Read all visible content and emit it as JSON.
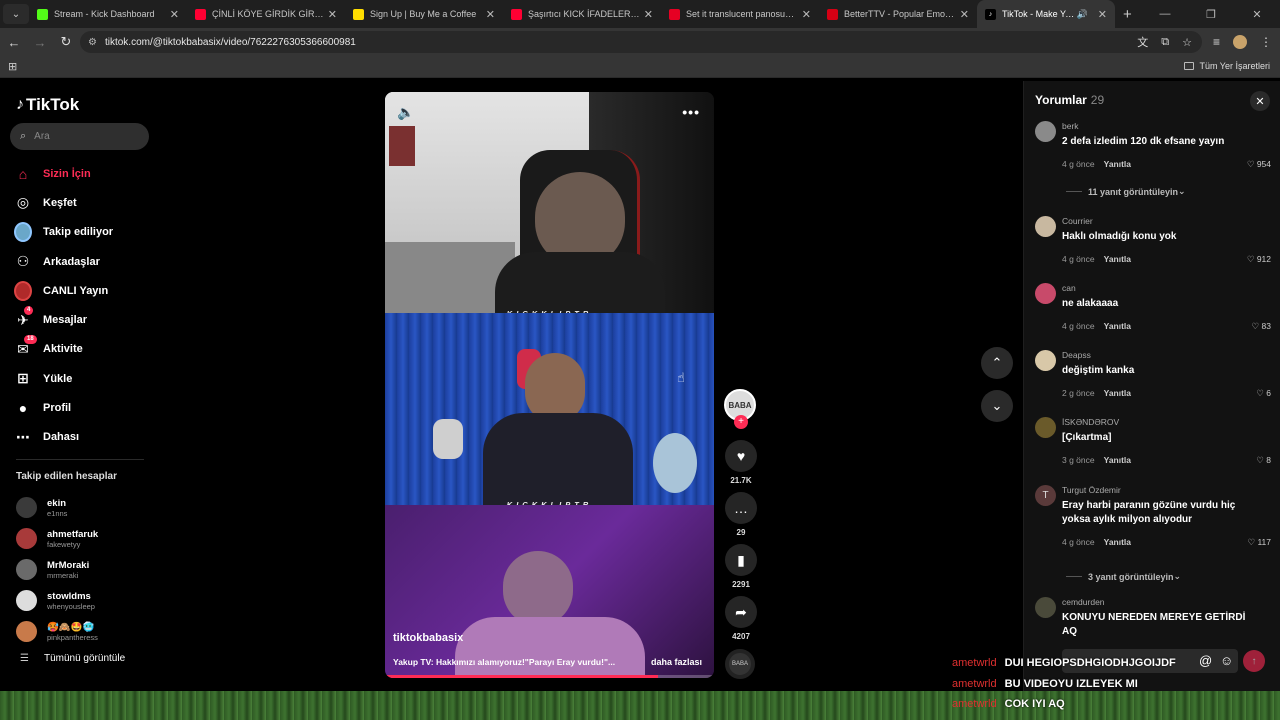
{
  "browser": {
    "tabs": [
      {
        "label": "Stream - Kick Dashboard",
        "icon": "kick-icon",
        "color": "#53fc18"
      },
      {
        "label": "ÇİNLİ KÖYE GİRDİK GİRMEZ OL",
        "icon": "youtube-icon",
        "color": "#ff0033"
      },
      {
        "label": "Sign Up | Buy Me a Coffee",
        "icon": "buymeacoffee-icon",
        "color": "#ffdd00"
      },
      {
        "label": "Şaşırtıcı KICK İFADELERİ ve GİF",
        "icon": "youtube-icon",
        "color": "#ff0033"
      },
      {
        "label": "Set it translucent panosundaki",
        "icon": "pinterest-icon",
        "color": "#e60023"
      },
      {
        "label": "BetterTTV - Popular Emotes",
        "icon": "betterttv-icon",
        "color": "#d50014"
      },
      {
        "label": "TikTok - Make Your Day",
        "icon": "tiktok-icon",
        "color": "#000000"
      }
    ],
    "url": "tiktok.com/@tiktokbabasix/video/7622276305366600981",
    "bookmarks_all": "Tüm Yer İşaretleri"
  },
  "sidebar": {
    "logo": "TikTok",
    "search_placeholder": "Ara",
    "nav": [
      {
        "label": "Sizin İçin",
        "icon": "home-icon",
        "active": true
      },
      {
        "label": "Keşfet",
        "icon": "compass-icon"
      },
      {
        "label": "Takip ediliyor",
        "icon": "following-avatar-icon"
      },
      {
        "label": "Arkadaşlar",
        "icon": "friends-icon"
      },
      {
        "label": "CANLI Yayın",
        "icon": "live-avatar-icon"
      },
      {
        "label": "Mesajlar",
        "icon": "messages-icon",
        "badge": "4"
      },
      {
        "label": "Aktivite",
        "icon": "activity-icon",
        "badge": "18"
      },
      {
        "label": "Yükle",
        "icon": "upload-icon"
      },
      {
        "label": "Profil",
        "icon": "profile-icon"
      },
      {
        "label": "Dahası",
        "icon": "more-icon"
      }
    ],
    "following_title": "Takip edilen hesaplar",
    "following": [
      {
        "name": "ekin",
        "user": "e1nns",
        "color": "#3a3a3a"
      },
      {
        "name": "ahmetfaruk",
        "user": "fakewetyy",
        "color": "#a83a3a"
      },
      {
        "name": "MrMoraki",
        "user": "mrmeraki",
        "color": "#6a6a6a"
      },
      {
        "name": "stowldms",
        "user": "whenyousleep",
        "color": "#dddddd"
      },
      {
        "name": "🥵🙈🤩🥶",
        "user": "pinkpantheress",
        "color": "#c87a4a"
      }
    ],
    "see_all": "Tümünü görüntüle"
  },
  "video": {
    "watermark": "KICKKLIPTR",
    "author": "tiktokbabasix",
    "description": "Yakup TV: Hakkımızı alamıyoruz!\"Parayı Eray vurdu!\"...",
    "more": "daha fazlası",
    "progress": 0.83
  },
  "actions": {
    "author_avatar_text": "BABA",
    "likes": "21.7K",
    "comments": "29",
    "saves": "2291",
    "shares": "4207"
  },
  "comments": {
    "title": "Yorumlar",
    "count": "29",
    "reply_label": "Yanıtla",
    "items": [
      {
        "user": "berk",
        "text": "2 defa izledim 120 dk efsane yayın",
        "time": "4 g önce",
        "likes": "954",
        "color": "#8a8a8a",
        "replies": "11 yanıt görüntüleyin"
      },
      {
        "user": "Courrier",
        "text": "Haklı olmadığı konu yok",
        "time": "4 g önce",
        "likes": "912",
        "color": "#c8b8a0"
      },
      {
        "user": "can",
        "text": "ne alakaaaa",
        "time": "4 g önce",
        "likes": "83",
        "color": "#c84a6a"
      },
      {
        "user": "Deapss",
        "text": "değiştim kanka",
        "time": "2 g önce",
        "likes": "6",
        "color": "#d8c8a8"
      },
      {
        "user": "İSKƏNDƏROV",
        "text": "[Çıkartma]",
        "time": "3 g önce",
        "likes": "8",
        "color": "#6a5a2a"
      },
      {
        "user": "Turgut Özdemir",
        "text": "Eray harbi paranın gözüne vurdu hiç yoksa aylık milyon alıyodur",
        "time": "4 g önce",
        "likes": "117",
        "color": "#5a3a3a",
        "initial": "T",
        "replies": "3 yanıt görüntüleyin"
      },
      {
        "user": "cemdurden",
        "text": "KONUYU NEREDEN MEREYE GETİRDİ AQ",
        "color": "#4a4a3a"
      }
    ]
  },
  "chat_overlay": [
    {
      "name": "ametwrld",
      "message": "DUI HEGIOPSDHGIODHJGOIJDF"
    },
    {
      "name": "ametwrld",
      "message": "BU VIDEOYU IZLEYEK MI"
    },
    {
      "name": "ametwrld",
      "message": "COK IYI AQ"
    }
  ]
}
